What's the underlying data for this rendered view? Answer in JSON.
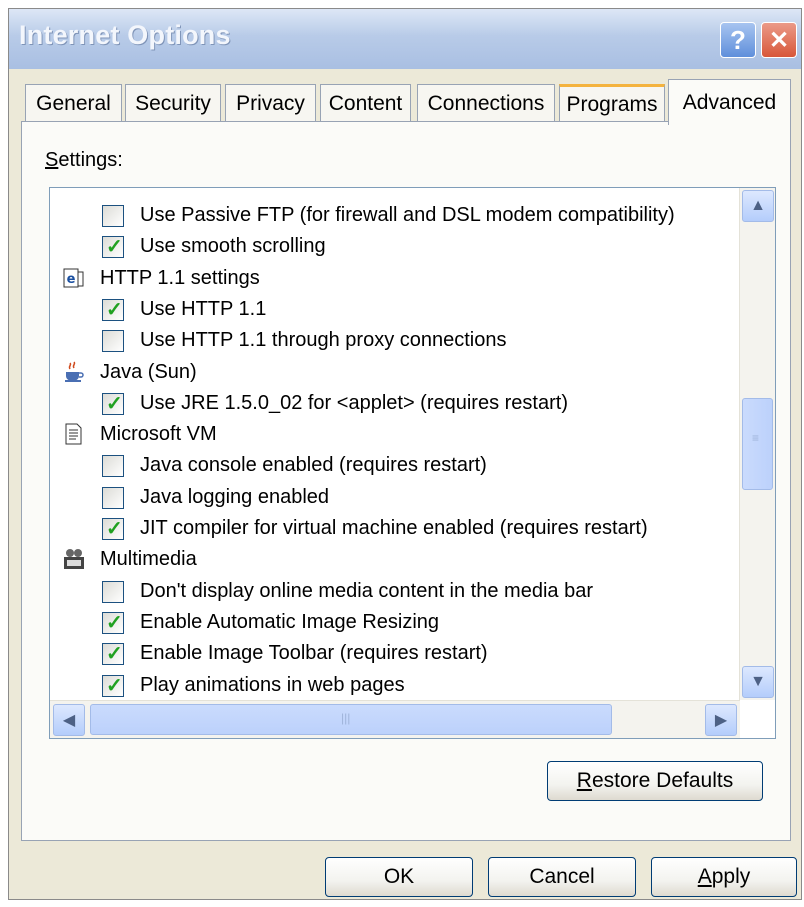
{
  "window": {
    "title": "Internet Options"
  },
  "titlebar": {
    "help_glyph": "?",
    "close_glyph": "✕"
  },
  "tabs": [
    {
      "label": "General"
    },
    {
      "label": "Security"
    },
    {
      "label": "Privacy"
    },
    {
      "label": "Content"
    },
    {
      "label": "Connections"
    },
    {
      "label": "Programs"
    },
    {
      "label": "Advanced"
    }
  ],
  "settings": {
    "label_first": "S",
    "label_rest": "ettings:",
    "rows": [
      {
        "type": "item",
        "checked": false,
        "label": "Use Passive FTP (for firewall and DSL modem compatibility)"
      },
      {
        "type": "item",
        "checked": true,
        "label": "Use smooth scrolling"
      },
      {
        "type": "group",
        "icon": "ie-settings-icon",
        "label": "HTTP 1.1 settings"
      },
      {
        "type": "item",
        "checked": true,
        "label": "Use HTTP 1.1"
      },
      {
        "type": "item",
        "checked": false,
        "label": "Use HTTP 1.1 through proxy connections"
      },
      {
        "type": "group",
        "icon": "java-cup-icon",
        "label": "Java (Sun)"
      },
      {
        "type": "item",
        "checked": true,
        "label": "Use JRE 1.5.0_02 for <applet> (requires restart)"
      },
      {
        "type": "group",
        "icon": "document-icon",
        "label": "Microsoft VM"
      },
      {
        "type": "item",
        "checked": false,
        "label": "Java console enabled (requires restart)"
      },
      {
        "type": "item",
        "checked": false,
        "label": "Java logging enabled"
      },
      {
        "type": "item",
        "checked": true,
        "label": "JIT compiler for virtual machine enabled (requires restart)"
      },
      {
        "type": "group",
        "icon": "multimedia-icon",
        "label": "Multimedia"
      },
      {
        "type": "item",
        "checked": false,
        "label": "Don't display online media content in the media bar"
      },
      {
        "type": "item",
        "checked": true,
        "label": "Enable Automatic Image Resizing"
      },
      {
        "type": "item",
        "checked": true,
        "label": "Enable Image Toolbar (requires restart)"
      },
      {
        "type": "item",
        "checked": true,
        "label": "Play animations in web pages"
      }
    ]
  },
  "buttons": {
    "restore_first": "R",
    "restore_rest": "estore Defaults",
    "ok": "OK",
    "cancel": "Cancel",
    "apply_first": "A",
    "apply_rest": "pply"
  },
  "colors": {
    "titlebar": "#b8cbe8",
    "dialog_bg": "#ece9d8",
    "checkmark": "#21a121",
    "tab_hover_accent": "#f4b33e"
  }
}
